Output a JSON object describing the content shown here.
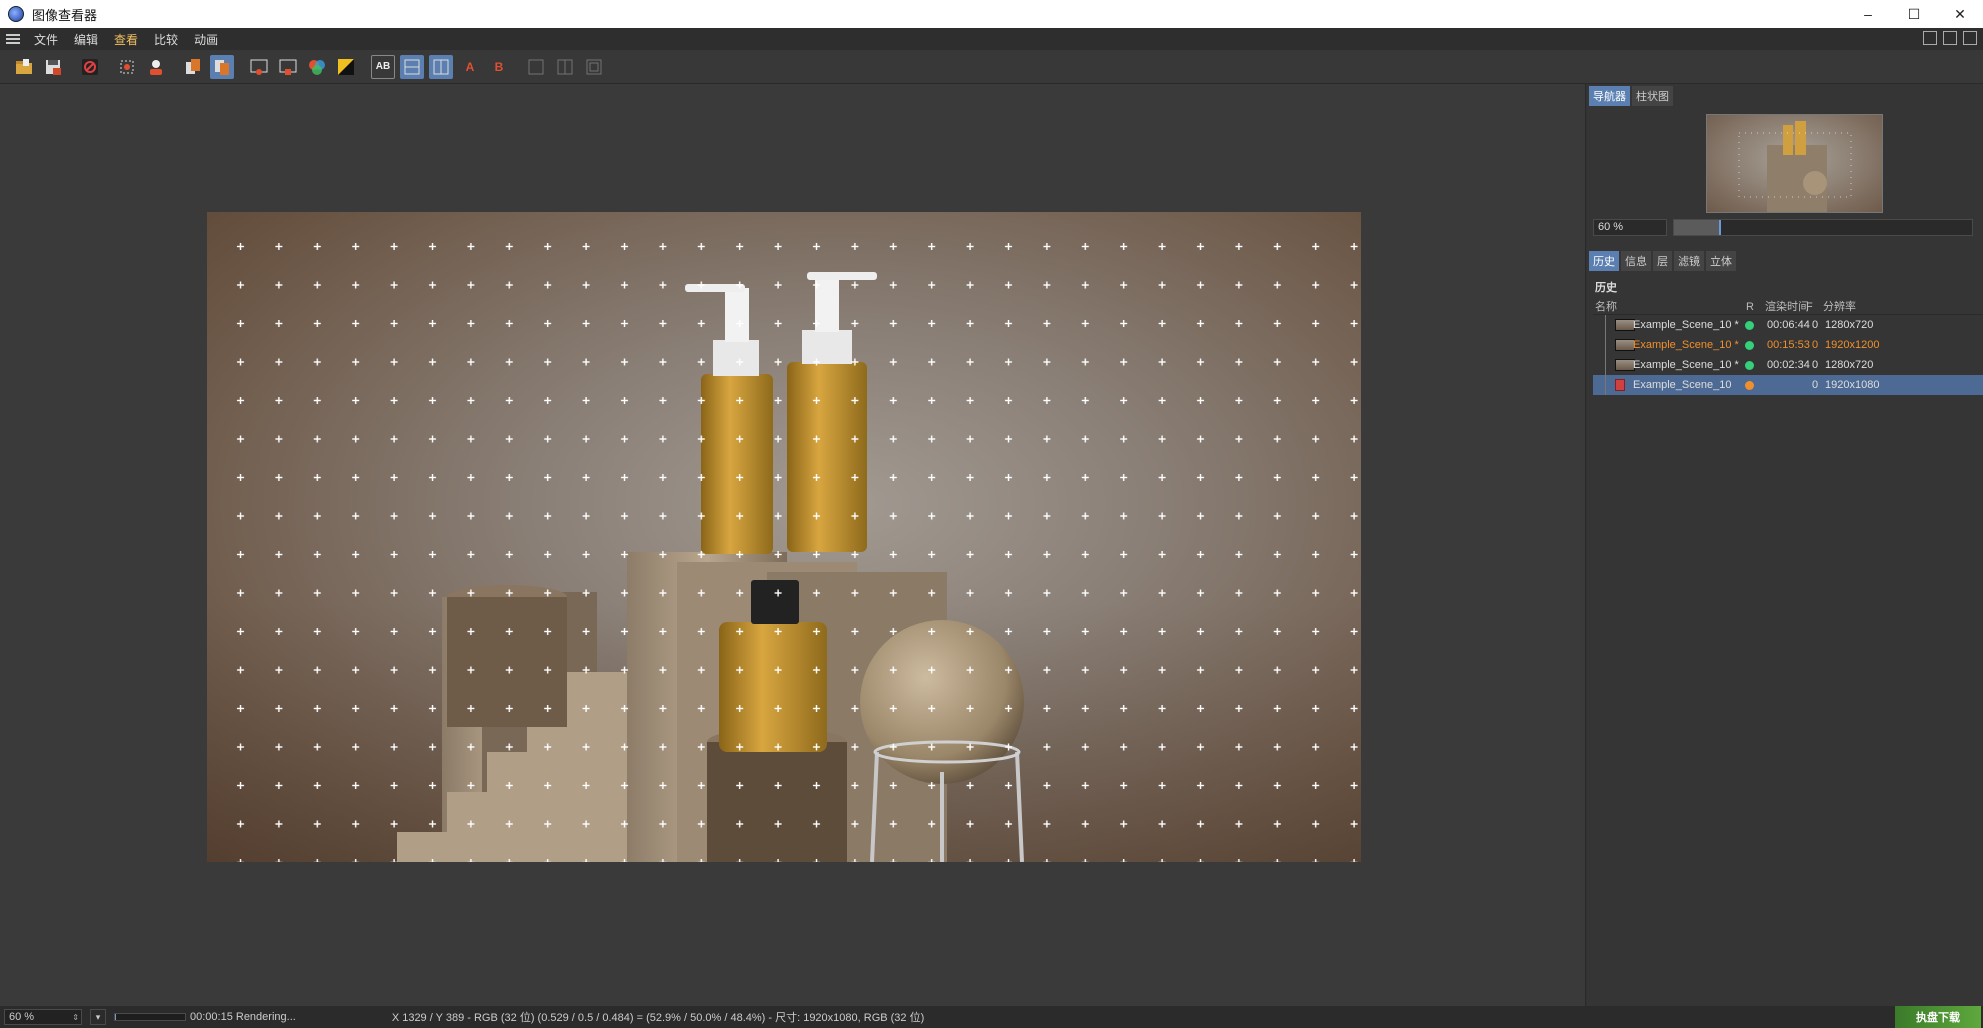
{
  "window": {
    "title": "图像查看器",
    "controls": {
      "minimize": "–",
      "maximize": "☐",
      "close": "✕"
    }
  },
  "menubar": {
    "items": [
      "文件",
      "编辑",
      "查看",
      "比较",
      "动画"
    ],
    "active_index": 2
  },
  "toolbar": {
    "ab_a": "A",
    "ab_b": "B",
    "ab_label": "AB"
  },
  "navigator": {
    "tabs": [
      "导航器",
      "柱状图"
    ],
    "active_tab": 0,
    "zoom_value": "60 %",
    "zoom_fraction": 0.15
  },
  "history_panel": {
    "tabs": [
      "历史",
      "信息",
      "层",
      "滤镜",
      "立体"
    ],
    "active_tab": 0,
    "header": "历史",
    "columns": {
      "name": "名称",
      "r": "R",
      "time": "渲染时间",
      "f": "F",
      "res": "分辨率"
    },
    "rows": [
      {
        "name": "Example_Scene_10 *",
        "status_color": "#35d07a",
        "time": "00:06:44",
        "f": "0",
        "res": "1280x720",
        "highlight": false,
        "selected": false
      },
      {
        "name": "Example_Scene_10 *",
        "status_color": "#35d07a",
        "time": "00:15:53",
        "f": "0",
        "res": "1920x1200",
        "highlight": true,
        "selected": false
      },
      {
        "name": "Example_Scene_10 *",
        "status_color": "#35d07a",
        "time": "00:02:34",
        "f": "0",
        "res": "1280x720",
        "highlight": false,
        "selected": false
      },
      {
        "name": "Example_Scene_10",
        "status_color": "#f0902c",
        "time": "",
        "f": "0",
        "res": "1920x1080",
        "highlight": false,
        "selected": true
      }
    ]
  },
  "statusbar": {
    "zoom": "60 %",
    "render_time": "00:00:15 Rendering...",
    "pixel_info": "X 1329 / Y 389 - RGB (32 位) (0.529 / 0.5 / 0.484) = (52.9% / 50.0% / 48.4%) - 尺寸: 1920x1080, RGB (32 位)",
    "logo_text": "执盘下载",
    "progress_fraction": 0.02
  },
  "colors": {
    "accent": "#5a7fb0",
    "highlight_row": "#f0902c",
    "status_ok": "#35d07a",
    "status_pending": "#f0902c"
  }
}
